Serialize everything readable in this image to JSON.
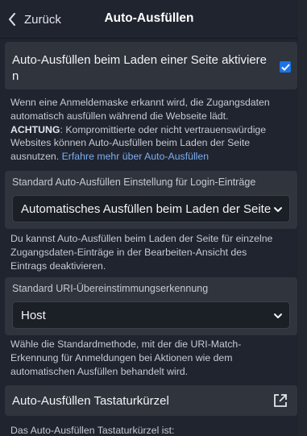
{
  "header": {
    "back_label": "Zurück",
    "title": "Auto-Ausfüllen"
  },
  "autofill_on_load": {
    "label_line1": "Auto-Ausfüllen beim Laden einer Seite aktiviere",
    "label_line2": "n",
    "checked": true,
    "help_line1": "Wenn eine Anmeldemaske erkannt wird, die Zugangsdaten",
    "help_line2": "automatisch ausfüllen während die Webseite lädt.",
    "warning_bold": "ACHTUNG",
    "warning_rest": ": Kompromittierte oder nicht vertrauenswürdige",
    "warning_line2": "Websites können Auto-Ausfüllen beim Laden der Seite",
    "warning_line3_pre": "ausnutzen. ",
    "learn_more_link": "Erfahre mehr über Auto-Ausfüllen"
  },
  "default_autofill": {
    "label": "Standard Auto-Ausfüllen Einstellung für Login-Einträge",
    "selected": "Automatisches Ausfüllen beim Laden der Seite",
    "help_line1": "Du kannst Auto-Ausfüllen beim Laden der Seite für einzelne",
    "help_line2": "Zugangsdaten-Einträge in der Bearbeiten-Ansicht des",
    "help_line3": "Eintrags deaktivieren."
  },
  "uri_match": {
    "label": "Standard URI-Übereinstimmungserkennung",
    "selected": "Host",
    "help_line1": "Wähle die Standardmethode, mit der die URI-Match-",
    "help_line2": "Erkennung für Anmeldungen bei Aktionen wie dem",
    "help_line3": "automatischen Ausfüllen behandelt wird."
  },
  "shortcut": {
    "label": "Auto-Ausfüllen Tastaturkürzel",
    "icon": "external-link-icon",
    "help_line1": "Das Auto-Ausfüllen Tastaturkürzel ist:"
  },
  "colors": {
    "background": "#1f242e",
    "card": "#2f343d",
    "accent": "#1a73e8",
    "link": "#7dadf2"
  }
}
